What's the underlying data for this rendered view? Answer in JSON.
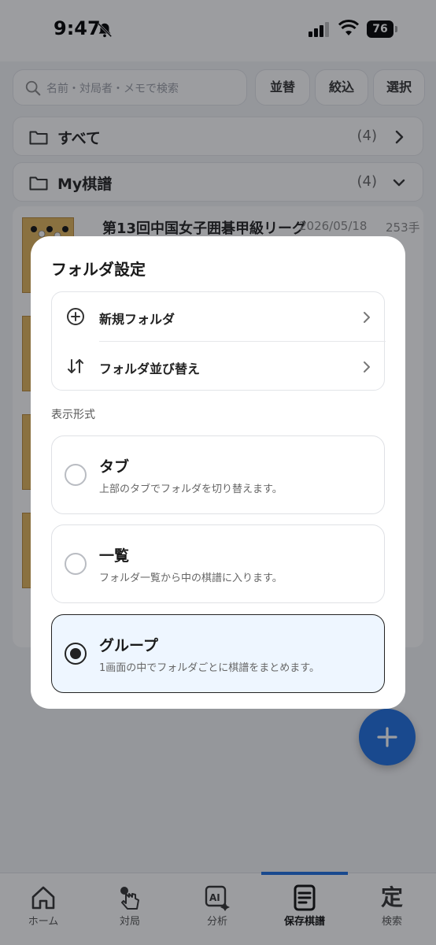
{
  "status_bar": {
    "time": "9:47",
    "battery": "76"
  },
  "search": {
    "placeholder": "名前・対局者・メモで検索"
  },
  "toolbar": {
    "sort_label": "並替",
    "filter_label": "絞込",
    "select_label": "選択"
  },
  "folders": [
    {
      "name": "すべて",
      "count": "(4)"
    },
    {
      "name": "My棋譜",
      "count": "(4)"
    }
  ],
  "games": [
    {
      "title": "第13回中国女子囲碁甲級リーグ",
      "date": "2026/05/18",
      "moves": "253手"
    }
  ],
  "modal": {
    "title": "フォルダ設定",
    "actions": [
      {
        "label": "新規フォルダ",
        "icon": "plus-circle-icon"
      },
      {
        "label": "フォルダ並び替え",
        "icon": "sort-arrows-icon"
      }
    ],
    "section_label": "表示形式",
    "options": [
      {
        "title": "タブ",
        "description": "上部のタブでフォルダを切り替えます。",
        "selected": false
      },
      {
        "title": "一覧",
        "description": "フォルダ一覧から中の棋譜に入ります。",
        "selected": false
      },
      {
        "title": "グループ",
        "description": "1画面の中でフォルダごとに棋譜をまとめます。",
        "selected": true
      }
    ]
  },
  "tab_bar": {
    "tabs": [
      {
        "label": "ホーム",
        "icon": "home-icon"
      },
      {
        "label": "対局",
        "icon": "hand-tap-icon"
      },
      {
        "label": "分析",
        "icon": "ai-sparkle-icon"
      },
      {
        "label": "保存棋譜",
        "icon": "document-icon",
        "active": true
      },
      {
        "label": "検索",
        "icon": "kanji-icon"
      }
    ],
    "last_tab_glyph": "定"
  },
  "colors": {
    "accent": "#1e6fe0",
    "selected_bg": "#eef6ff",
    "board": "#e1b45a"
  }
}
